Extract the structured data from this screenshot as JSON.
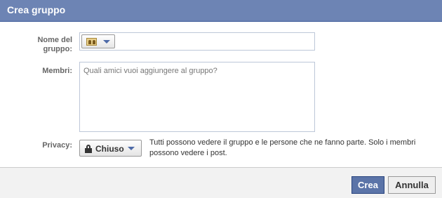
{
  "dialog": {
    "title": "Crea gruppo"
  },
  "form": {
    "name_label_line1": "Nome del",
    "name_label_line2": "gruppo:",
    "name_value": "",
    "group_icon": "group-people-icon",
    "members_label": "Membri:",
    "members_placeholder": "Quali amici vuoi aggiungere al gruppo?",
    "privacy_label": "Privacy:",
    "privacy_value": "Chiuso",
    "privacy_icon": "lock-icon",
    "privacy_description": "Tutti possono vedere il gruppo e le persone che ne fanno parte. Solo i membri possono vedere i post."
  },
  "footer": {
    "create_label": "Crea",
    "cancel_label": "Annulla"
  },
  "colors": {
    "titlebar": "#6d84b4",
    "primary_button": "#5b74a8",
    "field_border": "#bdc7d8"
  }
}
